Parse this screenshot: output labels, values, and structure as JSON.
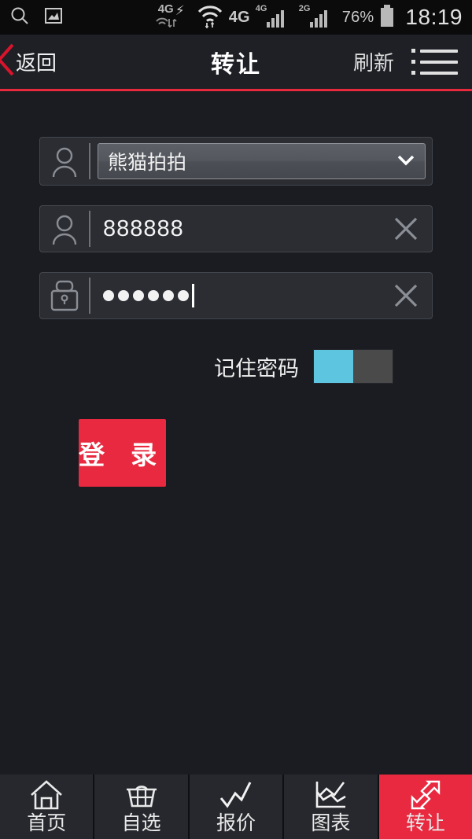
{
  "statusbar": {
    "left_icons": [
      "search-icon",
      "image-icon"
    ],
    "network_primary": "4G",
    "network_secondary": "4G",
    "network_tertiary": "2G",
    "wifi": "wifi-icon",
    "battery_percent": "76%",
    "time": "18:19"
  },
  "header": {
    "back_label": "返回",
    "title": "转让",
    "refresh_label": "刷新",
    "menu_icon": "list-menu-icon",
    "accent_color": "#e8283c"
  },
  "form": {
    "account_select": {
      "icon": "person-icon",
      "value": "熊猫拍拍",
      "caret": "chevron-down-icon"
    },
    "username_field": {
      "icon": "person-icon",
      "value": "888888",
      "placeholder": "",
      "clear_icon": "close-x-icon"
    },
    "password_field": {
      "icon": "lock-icon",
      "value": "••••••",
      "placeholder": "",
      "length": 6,
      "clear_icon": "close-x-icon"
    },
    "remember": {
      "label": "记住密码",
      "state": "on",
      "on_color": "#5ec5e0",
      "off_color": "#4a4a4a"
    },
    "login_label": "登 录",
    "login_color": "#e8293f"
  },
  "bottomnav": {
    "items": [
      {
        "label": "首页",
        "icon": "home-icon",
        "active": false
      },
      {
        "label": "自选",
        "icon": "basket-icon",
        "active": false
      },
      {
        "label": "报价",
        "icon": "trend-line-icon",
        "active": false
      },
      {
        "label": "图表",
        "icon": "line-chart-icon",
        "active": false
      },
      {
        "label": "转让",
        "icon": "transfer-arrows-icon",
        "active": true
      }
    ],
    "active_color": "#e8293f"
  }
}
